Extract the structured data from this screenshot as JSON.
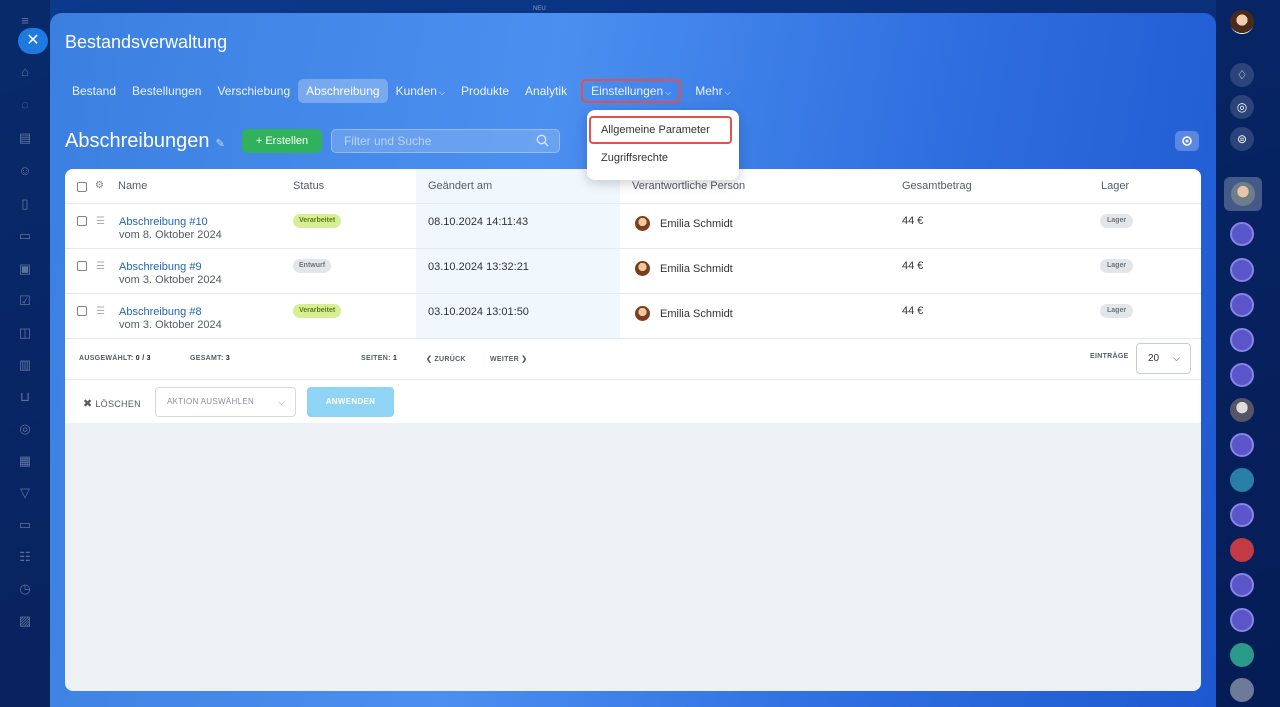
{
  "top_label": "NEU",
  "window": {
    "title": "Bestandsverwaltung",
    "close_icon": "close-icon"
  },
  "tabs": [
    {
      "label": "Bestand"
    },
    {
      "label": "Bestellungen"
    },
    {
      "label": "Verschiebung"
    },
    {
      "label": "Abschreibung",
      "active": true
    },
    {
      "label": "Kunden",
      "has_menu": true
    },
    {
      "label": "Produkte"
    },
    {
      "label": "Analytik"
    },
    {
      "label": "Einstellungen",
      "has_menu": true,
      "highlighted": true
    },
    {
      "label": "Mehr",
      "has_menu": true
    }
  ],
  "dropdown": {
    "items": [
      {
        "label": "Allgemeine Parameter",
        "highlighted": true
      },
      {
        "label": "Zugriffsrechte"
      }
    ]
  },
  "page": {
    "title": "Abschreibungen",
    "create_label": "+ Erstellen",
    "filter_placeholder": "Filter und Suche"
  },
  "table": {
    "headers": [
      "Name",
      "Status",
      "Geändert am",
      "Verantwortliche Person",
      "Gesamtbetrag",
      "Lager"
    ],
    "rows": [
      {
        "name": "Abschreibung #10",
        "date_line": "vom 8. Oktober 2024",
        "status": "Verarbeitet",
        "status_color": "green",
        "modified": "08.10.2024 14:11:43",
        "person": "Emilia Schmidt",
        "amount": "44 €",
        "warehouse": "Lager"
      },
      {
        "name": "Abschreibung #9",
        "date_line": "vom 3. Oktober 2024",
        "status": "Entwurf",
        "status_color": "gray",
        "modified": "03.10.2024 13:32:21",
        "person": "Emilia Schmidt",
        "amount": "44 €",
        "warehouse": "Lager"
      },
      {
        "name": "Abschreibung #8",
        "date_line": "vom 3. Oktober 2024",
        "status": "Verarbeitet",
        "status_color": "green",
        "modified": "03.10.2024 13:01:50",
        "person": "Emilia Schmidt",
        "amount": "44 €",
        "warehouse": "Lager"
      }
    ]
  },
  "footer": {
    "selected_label": "AUSGEWÄHLT:",
    "selected_value": "0 / 3",
    "total_label": "GESAMT:",
    "total_value": "3",
    "pages_label": "SEITEN:",
    "pages_value": "1",
    "prev_label": "ZURÜCK",
    "next_label": "WEITER",
    "per_page_label": "EINTRÄGE",
    "per_page_value": "20"
  },
  "actions": {
    "delete_label": "LÖSCHEN",
    "select_action_label": "AKTION AUSWÄHLEN",
    "apply_label": "ANWENDEN"
  },
  "colors": {
    "accent_red": "#e0524a",
    "create_green": "#2fb25b",
    "link_blue": "#2067b0"
  }
}
